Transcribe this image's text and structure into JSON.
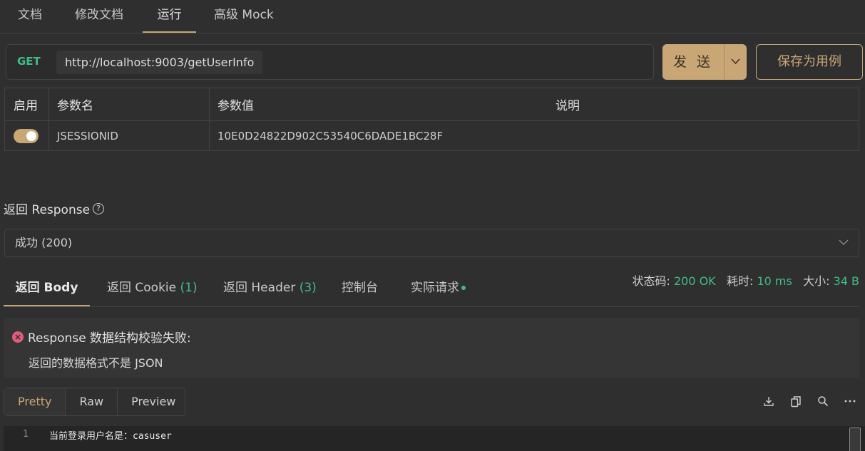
{
  "top_tabs": [
    "文档",
    "修改文档",
    "运行",
    "高级 Mock"
  ],
  "request": {
    "method": "GET",
    "url": "http://localhost:9003/getUserInfo",
    "send_label": "发 送",
    "save_label": "保存为用例"
  },
  "params": {
    "headers": [
      "启用",
      "参数名",
      "参数值",
      "说明"
    ],
    "rows": [
      {
        "enabled": true,
        "name": "JSESSIONID",
        "value": "10E0D24822D902C53540C6DADE1BC28F",
        "desc": ""
      }
    ]
  },
  "response": {
    "title": "返回 Response",
    "status_option": "成功 (200)",
    "tabs": {
      "body": "返回 Body",
      "cookie_label": "返回 Cookie",
      "cookie_count": "(1)",
      "header_label": "返回 Header",
      "header_count": "(3)",
      "console": "控制台",
      "actual_request": "实际请求"
    },
    "metrics": {
      "status_label": "状态码:",
      "status_value": "200 OK",
      "time_label": "耗时:",
      "time_value": "10 ms",
      "size_label": "大小:",
      "size_value": "34 B"
    },
    "error": {
      "title": "Response 数据结构校验失败:",
      "message": "返回的数据格式不是 JSON"
    },
    "modes": [
      "Pretty",
      "Raw",
      "Preview"
    ],
    "code": {
      "line_number": "1",
      "line_text": "当前登录用户名是：casuser"
    }
  },
  "colors": {
    "accent": "#c8a676",
    "success": "#3fbd85",
    "error": "#e05c7a"
  }
}
